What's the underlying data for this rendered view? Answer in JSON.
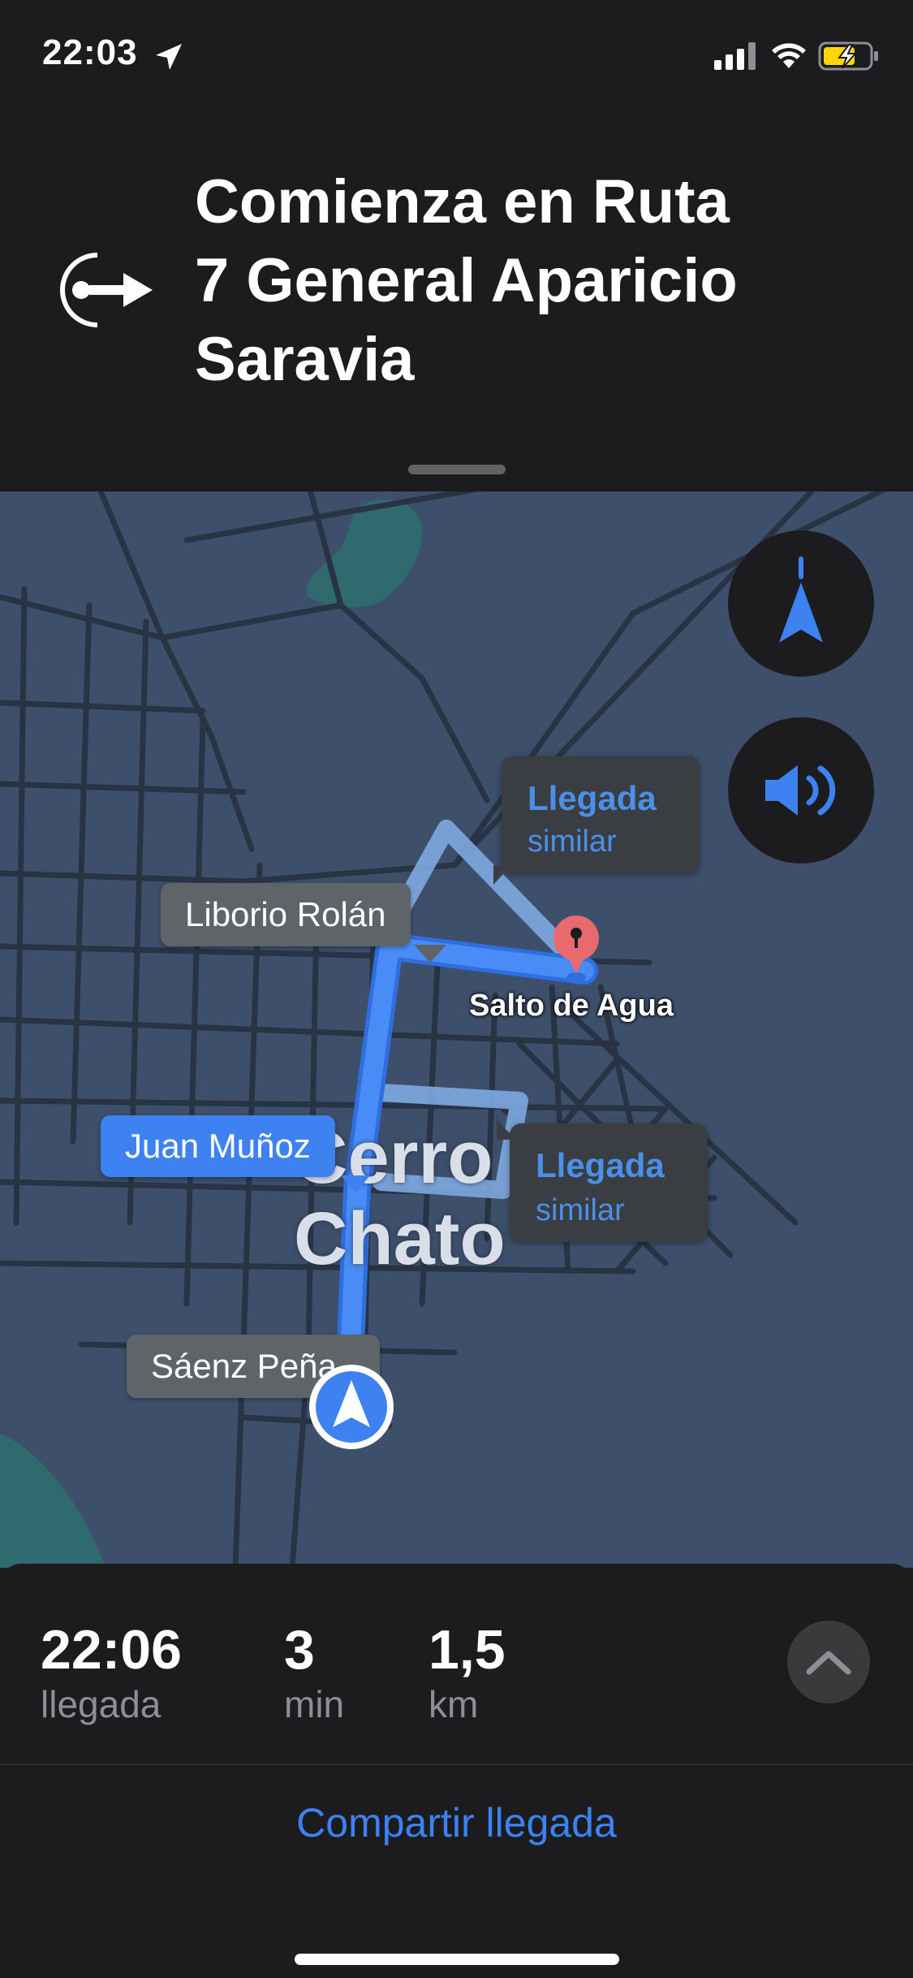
{
  "status_bar": {
    "time": "22:03",
    "icons": [
      "location-arrow-icon",
      "cellular-signal-icon",
      "wifi-icon",
      "battery-charging-icon"
    ]
  },
  "navigation": {
    "maneuver_icon": "start-route-arrow-icon",
    "instruction_lines": [
      "Comienza en Ruta",
      "7 General Aparicio",
      "Saravia"
    ]
  },
  "map": {
    "buttons": {
      "compass_icon": "north-arrow-icon",
      "audio_icon": "speaker-volume-icon"
    },
    "alt_routes": [
      {
        "title": "Llegada",
        "subtitle": "similar"
      },
      {
        "title": "Llegada",
        "subtitle": "similar"
      }
    ],
    "road_labels": {
      "liborio": "Liborio Rolán",
      "juan": "Juan Muñoz",
      "saenz": "Sáenz Peña"
    },
    "city_label": {
      "line1": "Cerro",
      "line2": "Chato"
    },
    "destination": {
      "name": "Salto de Agua",
      "icon": "destination-pin-icon"
    },
    "user_location_icon": "navigation-arrow-icon"
  },
  "trip": {
    "arrival": {
      "value": "22:06",
      "label": "llegada"
    },
    "duration": {
      "value": "3",
      "label": "min"
    },
    "distance": {
      "value": "1,5",
      "label": "km"
    },
    "expand_icon": "chevron-up-icon",
    "share_label": "Compartir llegada"
  },
  "colors": {
    "route": "#3d82f0",
    "map_bg": "#3d4f6a",
    "accent": "#3b82f6",
    "background": "#1c1c1e"
  }
}
